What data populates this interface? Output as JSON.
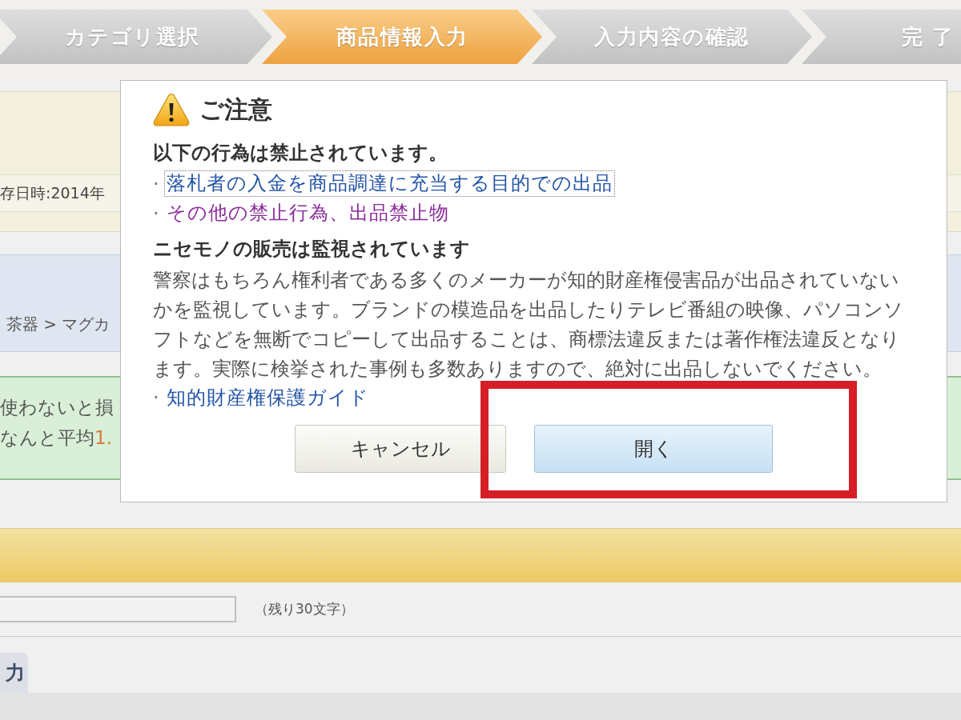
{
  "steps": [
    {
      "label": "カテゴリ選択",
      "selected": false
    },
    {
      "label": "商品情報入力",
      "selected": true
    },
    {
      "label": "入力内容の確認",
      "selected": false
    },
    {
      "label": "完 了",
      "selected": false
    }
  ],
  "background": {
    "saved_info": "存日時:2014年",
    "category_path": "茶器 > マグカ",
    "promo": {
      "line_1": "使わないと損",
      "line_2": {
        "text": "なんと平均",
        "highlight": "1."
      }
    },
    "title_field": {
      "counter": "（残り30文字）"
    },
    "tab": {
      "label": "力"
    }
  },
  "dialog": {
    "title": "ご注意",
    "prohibited_heading": "以下の行為は禁止されています。",
    "prohibited_links": [
      {
        "bullet": "·",
        "label": "落札者の入金を商品調達に充当する目的での出品",
        "visited": false,
        "focused": true
      },
      {
        "bullet": "·",
        "label": "その他の禁止行為、出品禁止物",
        "visited": true,
        "focused": false
      }
    ],
    "counterfeit_heading": "ニセモノの販売は監視されています",
    "counterfeit_text": "警察はもちろん権利者である多くのメーカーが知的財産権侵害品が出品されていないかを監視しています。ブランドの模造品を出品したりテレビ番組の映像、パソコンソフトなどを無断でコピーして出品することは、商標法違反または著作権法違反となります。実際に検挙された事例も多数ありますので、絶対に出品しないでください。",
    "guide_link": {
      "bullet": "·",
      "label": "知的財産権保護ガイド",
      "visited": false,
      "focused": false
    },
    "buttons": [
      {
        "label": "キャンセル",
        "kind": "secondary"
      },
      {
        "label": "開く",
        "kind": "primary"
      }
    ]
  },
  "annotation": {
    "kind": "frame"
  }
}
